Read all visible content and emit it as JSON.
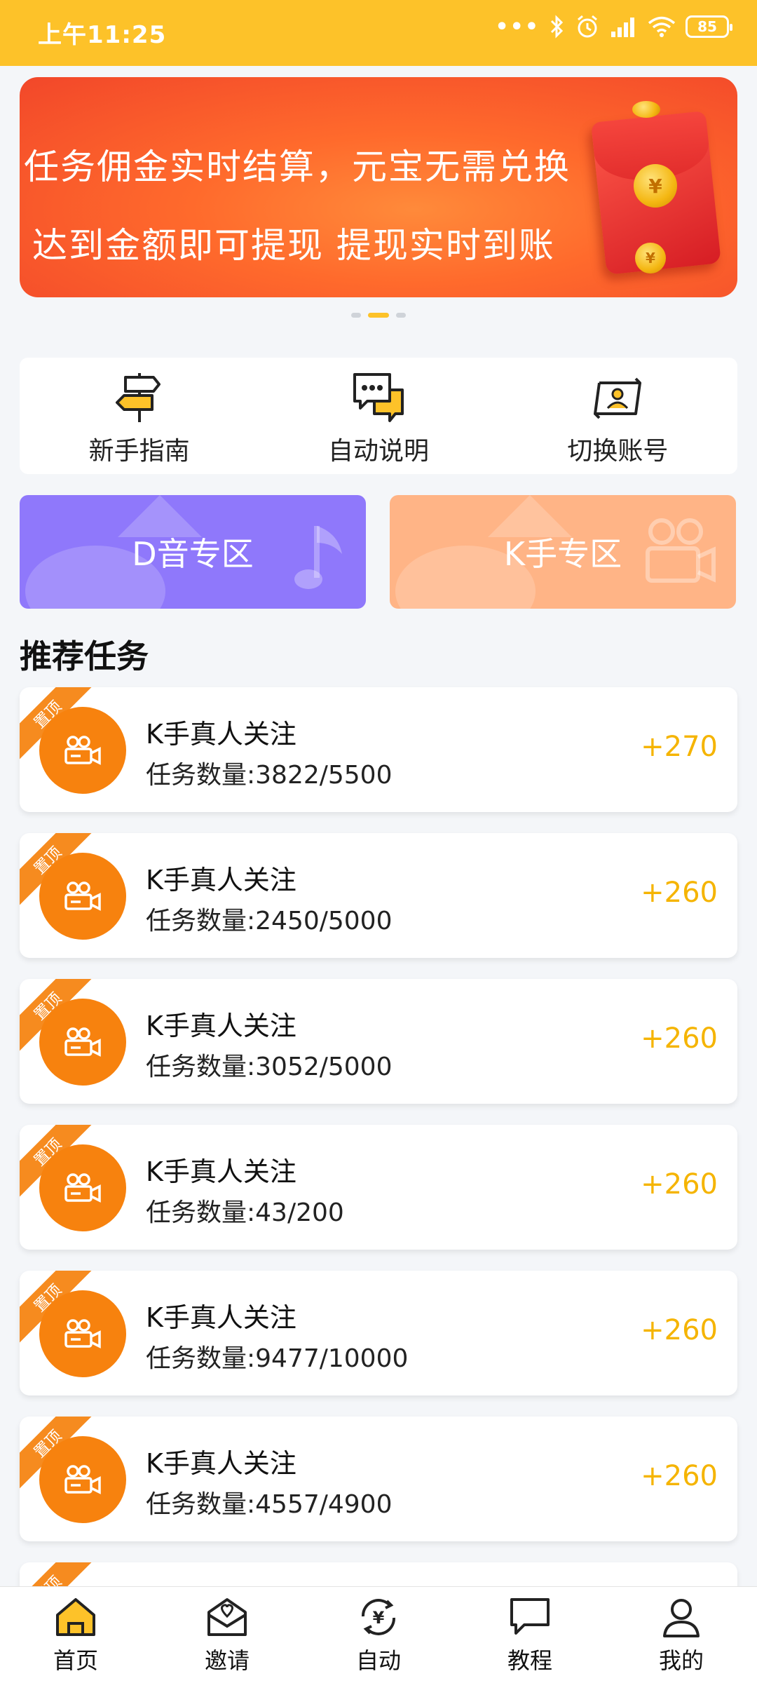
{
  "status": {
    "time": "上午11:25",
    "battery": "85"
  },
  "banner": {
    "line1": "任务佣金实时结算，元宝无需兑换",
    "line2": "达到金额即可提现  提现实时到账"
  },
  "quick": [
    {
      "label": "新手指南",
      "icon": "signpost-icon"
    },
    {
      "label": "自动说明",
      "icon": "chat-bubbles-icon"
    },
    {
      "label": "切换账号",
      "icon": "switch-account-icon"
    }
  ],
  "zones": {
    "d": "D音专区",
    "k": "K手专区"
  },
  "section_title": "推荐任务",
  "tasks": [
    {
      "badge": "置顶",
      "name": "K手真人关注",
      "count": "任务数量:3822/5500",
      "reward": "+270"
    },
    {
      "badge": "置顶",
      "name": "K手真人关注",
      "count": "任务数量:2450/5000",
      "reward": "+260"
    },
    {
      "badge": "置顶",
      "name": "K手真人关注",
      "count": "任务数量:3052/5000",
      "reward": "+260"
    },
    {
      "badge": "置顶",
      "name": "K手真人关注",
      "count": "任务数量:43/200",
      "reward": "+260"
    },
    {
      "badge": "置顶",
      "name": "K手真人关注",
      "count": "任务数量:9477/10000",
      "reward": "+260"
    },
    {
      "badge": "置顶",
      "name": "K手真人关注",
      "count": "任务数量:4557/4900",
      "reward": "+260"
    }
  ],
  "tabs": [
    {
      "label": "首页",
      "icon": "home-icon"
    },
    {
      "label": "邀请",
      "icon": "invite-envelope-icon"
    },
    {
      "label": "自动",
      "icon": "yuan-refresh-icon"
    },
    {
      "label": "教程",
      "icon": "message-icon"
    },
    {
      "label": "我的",
      "icon": "user-icon"
    }
  ],
  "colors": {
    "accent": "#fdc229",
    "reward": "#f5b400",
    "ribbon": "#f68b1f",
    "avatar": "#f7820e",
    "zone_d": "#8f78fb",
    "zone_k": "#ffb486"
  }
}
